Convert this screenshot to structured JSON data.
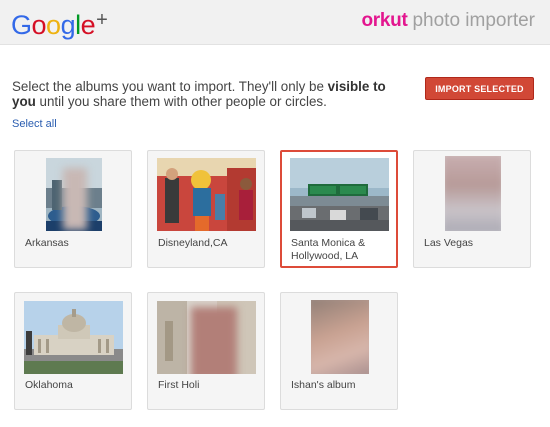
{
  "header": {
    "google_logo": [
      "G",
      "o",
      "o",
      "g",
      "l",
      "e"
    ],
    "google_colors": [
      "#3369e8",
      "#d50f25",
      "#eeb211",
      "#3369e8",
      "#009925",
      "#d50f25"
    ],
    "plus": "+",
    "brand_name": "orkut",
    "product_name": "photo importer"
  },
  "intro": {
    "text_before": "Select the albums you want to import. They'll only be ",
    "text_bold": "visible to you",
    "text_after": " until you share them with other people or circles."
  },
  "import_button": "IMPORT SELECTED",
  "select_all": "Select all",
  "albums": [
    {
      "label": "Arkansas",
      "selected": false
    },
    {
      "label": "Disneyland,CA",
      "selected": false
    },
    {
      "label": "Santa Monica & Hollywood, LA",
      "selected": true
    },
    {
      "label": "Las Vegas",
      "selected": false
    },
    {
      "label": "Oklahoma",
      "selected": false
    },
    {
      "label": "First Holi",
      "selected": false
    },
    {
      "label": "Ishan's album",
      "selected": false
    }
  ],
  "colors": {
    "accent": "#d14836",
    "selected_border": "#dd4b39",
    "link": "#2a5db0",
    "orkut_pink": "#e3168f"
  }
}
